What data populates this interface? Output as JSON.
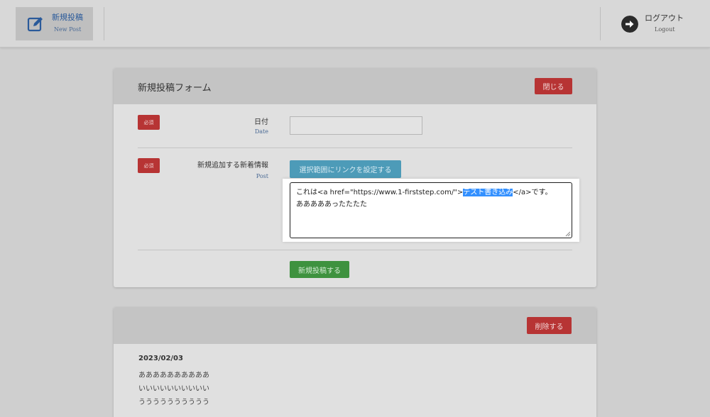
{
  "header": {
    "new_post": {
      "label": "新規投稿",
      "sublabel": "New Post",
      "icon": "edit-icon"
    },
    "logout": {
      "label": "ログアウト",
      "sublabel": "Logout",
      "icon": "arrow-right-circle-icon"
    }
  },
  "form": {
    "title": "新規投稿フォーム",
    "close_label": "閉じる",
    "required_badge": "必須",
    "date_label": "日付",
    "date_sublabel": "Date",
    "date_value": "",
    "post_label": "新規追加する新着情報",
    "post_sublabel": "Post",
    "link_button_label": "選択範囲にリンクを設定する",
    "textarea": {
      "line1_before": "これは<a href=\"https://www.1-firststep.com/\">",
      "line1_selected": "テスト書き込み",
      "line1_after": "</a>です。",
      "line2": "あああああったたたた"
    },
    "submit_label": "新規投稿する"
  },
  "posts": [
    {
      "delete_label": "削除する",
      "date": "2023/02/03",
      "lines": [
        "ああああああああああ",
        "いいいいいいいいいい",
        "うううううううううう"
      ]
    }
  ],
  "colors": {
    "red": "#b73434",
    "blue": "#4d9bb8",
    "green": "#3e923f",
    "selection": "#3390ff"
  }
}
